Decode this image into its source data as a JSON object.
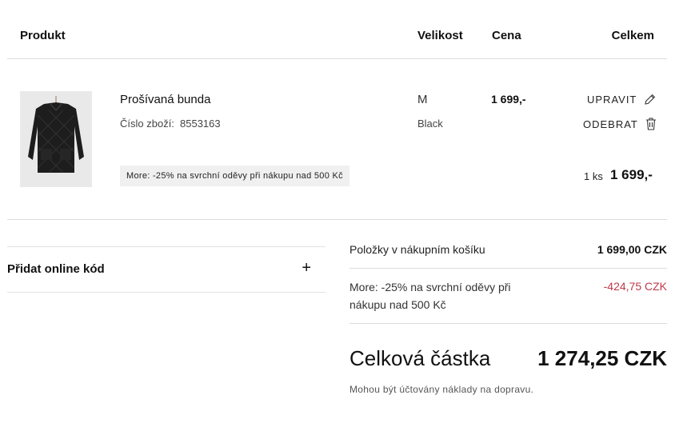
{
  "header": {
    "product": "Produkt",
    "size": "Velikost",
    "price": "Cena",
    "total": "Celkem"
  },
  "item": {
    "name": "Prošívaná bunda",
    "sku_label": "Číslo zboží:",
    "sku_value": "8553163",
    "size": "M",
    "color_name": "Black",
    "price": "1 699,-",
    "edit_label": "UPRAVIT",
    "remove_label": "ODEBRAT",
    "promo_text": "More: -25% na svrchní oděvy při nákupu nad 500 Kč",
    "quantity": "1 ks",
    "line_total": "1 699,-",
    "image_icon": "jacket-image"
  },
  "promo_code": {
    "label": "Přidat online kód",
    "expand_symbol": "+"
  },
  "summary": {
    "items_label": "Položky v nákupním košíku",
    "items_value": "1 699,00 CZK",
    "discount_label": "More: -25% na svrchní oděvy při nákupu nad 500 Kč",
    "discount_value": "-424,75 CZK",
    "total_label": "Celková částka",
    "total_value": "1 274,25 CZK",
    "shipping_note": "Mohou být účtovány náklady na dopravu."
  },
  "colors": {
    "discount": "#c0394a",
    "divider": "#dcdcdc",
    "badge_bg": "#f0f0f0"
  }
}
